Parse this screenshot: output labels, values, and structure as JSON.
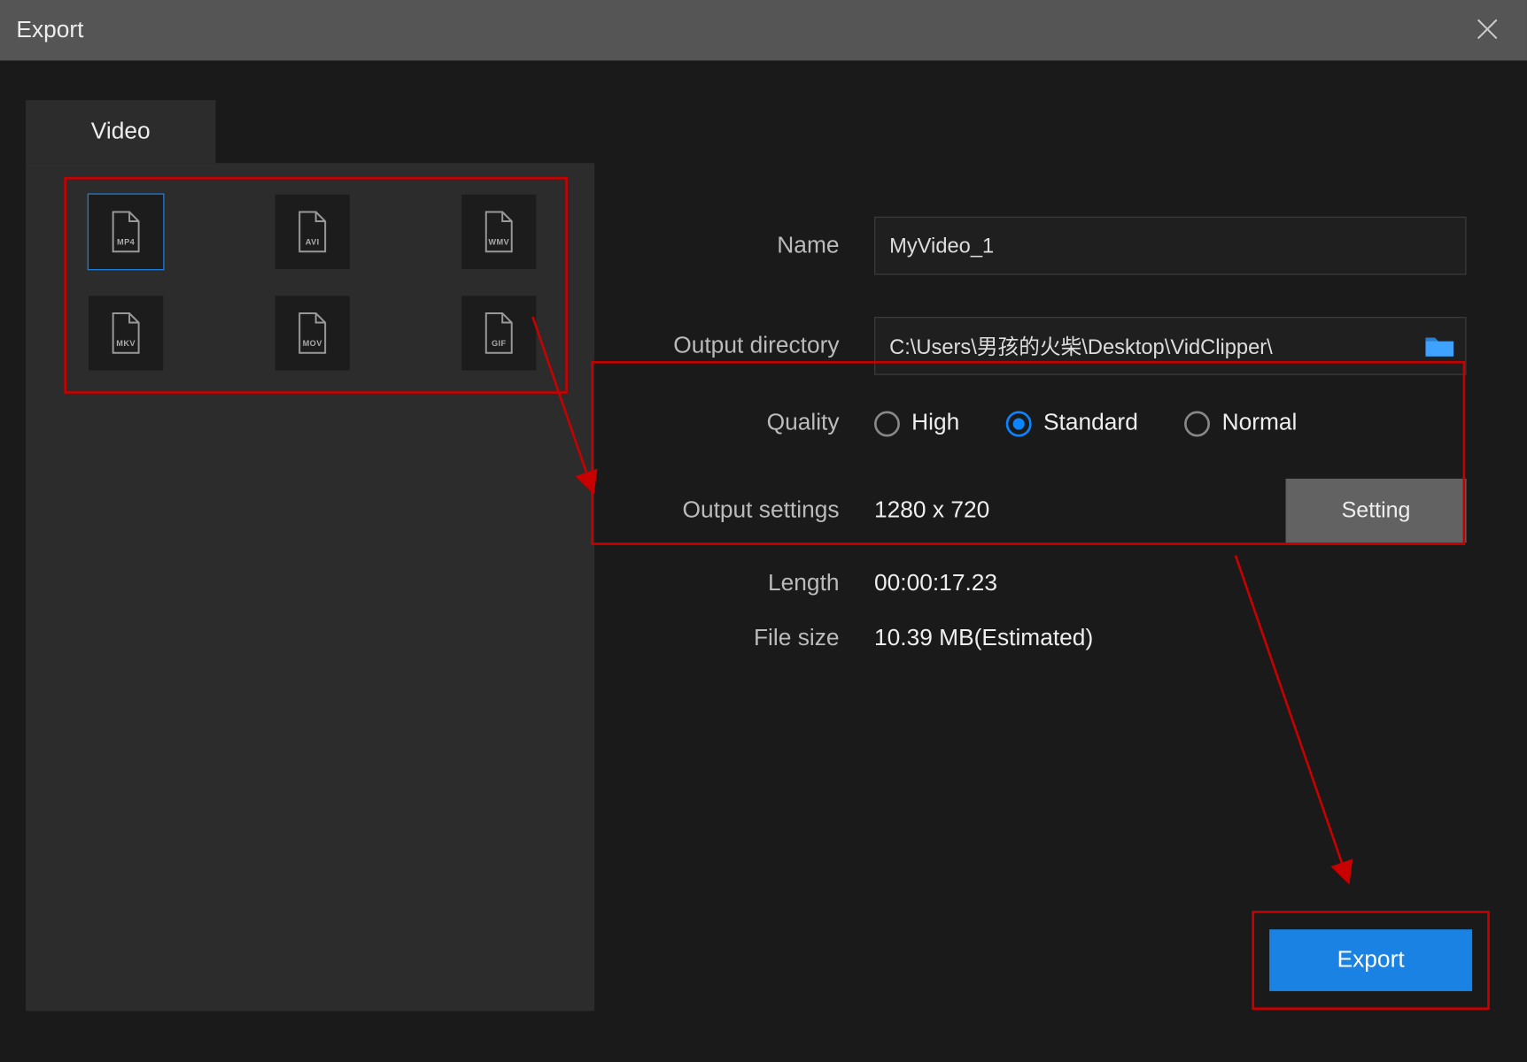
{
  "title": "Export",
  "tab": {
    "label": "Video"
  },
  "formats": [
    {
      "name": "MP4",
      "selected": true
    },
    {
      "name": "AVI",
      "selected": false
    },
    {
      "name": "WMV",
      "selected": false
    },
    {
      "name": "MKV",
      "selected": false
    },
    {
      "name": "MOV",
      "selected": false
    },
    {
      "name": "GIF",
      "selected": false
    }
  ],
  "form": {
    "name_label": "Name",
    "name_value": "MyVideo_1",
    "dir_label": "Output directory",
    "dir_value": "C:\\Users\\男孩的火柴\\Desktop\\VidClipper\\",
    "quality_label": "Quality",
    "quality_options": [
      "High",
      "Standard",
      "Normal"
    ],
    "quality_selected": "Standard",
    "output_label": "Output settings",
    "output_value": "1280 x 720",
    "setting_btn": "Setting",
    "length_label": "Length",
    "length_value": "00:00:17.23",
    "size_label": "File size",
    "size_value": "10.39 MB(Estimated)"
  },
  "export_btn": "Export",
  "annotation_color": "#c80000"
}
